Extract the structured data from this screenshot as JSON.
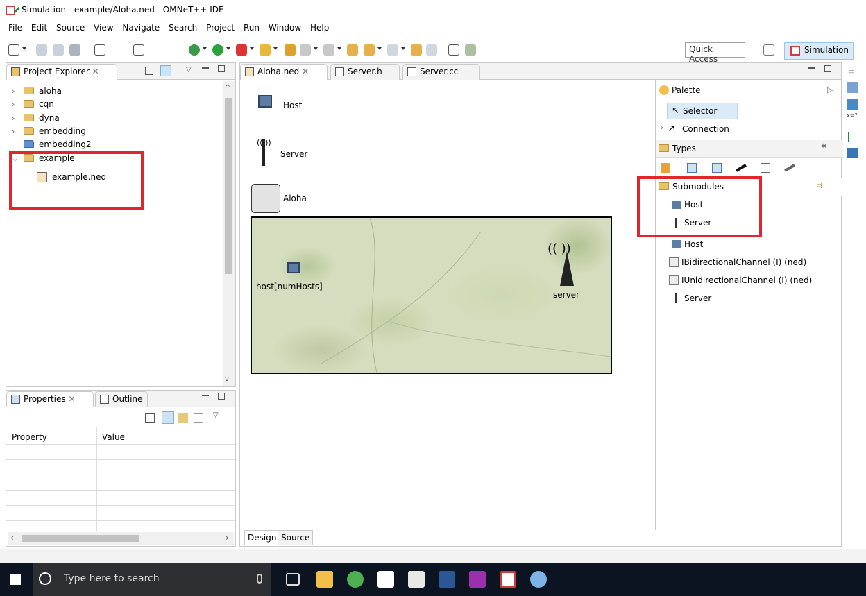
{
  "window": {
    "title": "Simulation - example/Aloha.ned - OMNeT++ IDE"
  },
  "menu": [
    "File",
    "Edit",
    "Source",
    "View",
    "Navigate",
    "Search",
    "Project",
    "Run",
    "Window",
    "Help"
  ],
  "toolbar": {
    "quick_access": "Quick Access",
    "perspective": "Simulation"
  },
  "project_explorer": {
    "tab": "Project Explorer",
    "items": [
      {
        "label": "aloha"
      },
      {
        "label": "cqn"
      },
      {
        "label": "dyna"
      },
      {
        "label": "embedding"
      },
      {
        "label": "embedding2"
      },
      {
        "label": "example"
      },
      {
        "label": "example.ned"
      }
    ]
  },
  "bottom_left": {
    "tabs": [
      "Properties",
      "Outline"
    ],
    "columns": [
      "Property",
      "Value"
    ]
  },
  "editor": {
    "tabs": [
      "Aloha.ned",
      "Server.h",
      "Server.cc"
    ],
    "types": [
      {
        "label": "Host"
      },
      {
        "label": "Server"
      },
      {
        "label": "Aloha"
      }
    ],
    "nodes": {
      "host": "host[numHosts]",
      "server": "server"
    },
    "bottom_tabs": [
      "Design",
      "Source"
    ]
  },
  "palette": {
    "title": "Palette",
    "selector": "Selector",
    "connection": "Connection",
    "types": "Types",
    "submodules_header": "Submodules",
    "submodules": [
      "Host",
      "Server"
    ],
    "more": [
      "Host",
      "IBidirectionalChannel (I) (ned)",
      "IUnidirectionalChannel (I) (ned)",
      "Server"
    ]
  },
  "taskbar": {
    "search_placeholder": "Type here to search"
  },
  "colors": {
    "highlight": "#e2262e",
    "accent": "#dbeaf7"
  }
}
